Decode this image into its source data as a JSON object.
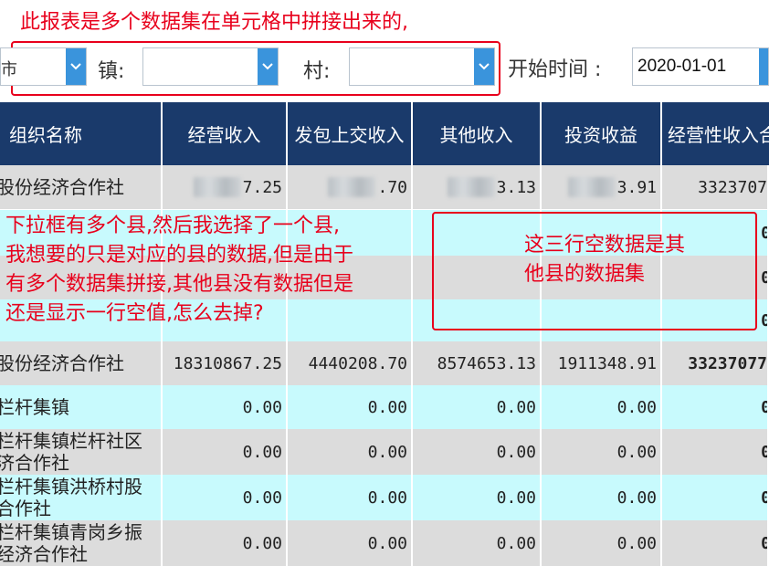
{
  "annotations": {
    "top_note": "此报表是多个数据集在单元格中拼接出来的,",
    "left_note_lines": [
      "下拉框有多个县,然后我选择了一个县,",
      "我想要的只是对应的县的数据,但是由于",
      "有多个数据集拼接,其他县没有数据但是",
      "还是显示一行空值,怎么去掉?"
    ],
    "mid_note_lines": [
      "这三行空数据是其",
      "他县的数据集"
    ]
  },
  "filters": {
    "city_value": "市",
    "town_label": "镇:",
    "town_value": "",
    "village_label": "村:",
    "village_value": "",
    "start_time_label": "开始时间 :",
    "start_date": "2020-01-01"
  },
  "table": {
    "headers": [
      "组织名称",
      "经营收入",
      "发包上交收入",
      "其他收入",
      "投资收益",
      "经营性收入合"
    ],
    "rows": [
      {
        "name": "股份经济合作社",
        "values": [
          "7.25",
          ".70",
          "3.13",
          "3.91",
          "3323707"
        ],
        "blurred": true
      },
      {
        "name": "",
        "values": [
          "",
          "",
          "",
          "",
          "0"
        ],
        "blurred": false
      },
      {
        "name": "",
        "values": [
          "",
          "",
          "",
          "",
          "0"
        ],
        "blurred": false
      },
      {
        "name": "",
        "values": [
          "",
          "",
          "",
          "",
          "0"
        ],
        "blurred": false
      },
      {
        "name": "股份经济合作社",
        "values": [
          "18310867.25",
          "4440208.70",
          "8574653.13",
          "1911348.91",
          "33237077"
        ],
        "blurred": false,
        "bold_last": true
      },
      {
        "name": "栏杆集镇",
        "values": [
          "0.00",
          "0.00",
          "0.00",
          "0.00",
          "0"
        ],
        "blurred": false
      },
      {
        "name": "栏杆集镇栏杆社区济合作社",
        "values": [
          "0.00",
          "0.00",
          "0.00",
          "0.00",
          "0"
        ],
        "blurred": false
      },
      {
        "name": "栏杆集镇洪桥村股合作社",
        "values": [
          "0.00",
          "0.00",
          "0.00",
          "0.00",
          "0"
        ],
        "blurred": false
      },
      {
        "name": "栏杆集镇青岗乡振经济合作社",
        "values": [
          "0.00",
          "0.00",
          "0.00",
          "0.00",
          "0"
        ],
        "blurred": false
      }
    ]
  },
  "colors": {
    "header_bg": "#1a3a6b",
    "row_gray": "#dcdcdc",
    "row_cyan": "#c8fafd",
    "annotation_red": "#e8001c",
    "combo_arrow": "#3a94dc"
  }
}
